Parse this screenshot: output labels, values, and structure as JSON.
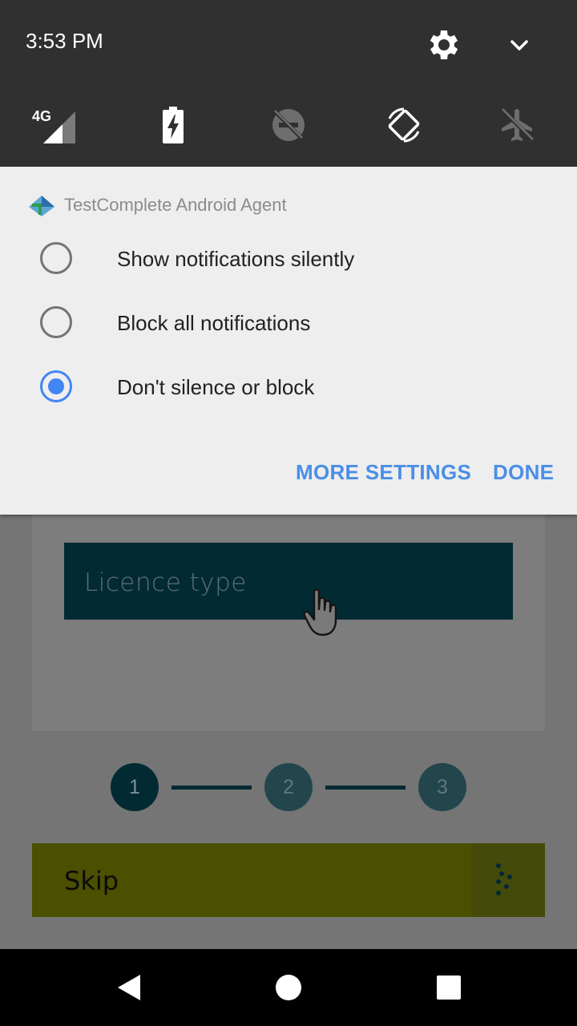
{
  "status_bar": {
    "time": "3:53 PM",
    "signal_label": "4G"
  },
  "quick_settings": {
    "icons": [
      "settings-icon",
      "chevron-down-icon",
      "signal-4g-icon",
      "battery-charging-icon",
      "dnd-off-icon",
      "auto-rotate-icon",
      "airplane-mode-icon"
    ]
  },
  "notification": {
    "app_name": "TestComplete Android Agent",
    "options": [
      {
        "label": "Show notifications silently",
        "checked": false
      },
      {
        "label": "Block all notifications",
        "checked": false
      },
      {
        "label": "Don't silence or block",
        "checked": true
      }
    ],
    "more_settings": "MORE SETTINGS",
    "done": "DONE",
    "accent_color": "#4285f4"
  },
  "app": {
    "licence_placeholder": "Licence type",
    "steps": [
      "1",
      "2",
      "3"
    ],
    "active_step": 1,
    "skip_label": "Skip",
    "primary_color": "#022a33",
    "skip_bar_color": "#4a5000"
  },
  "nav_bar": {
    "buttons": [
      "back-icon",
      "home-icon",
      "recents-icon"
    ]
  }
}
